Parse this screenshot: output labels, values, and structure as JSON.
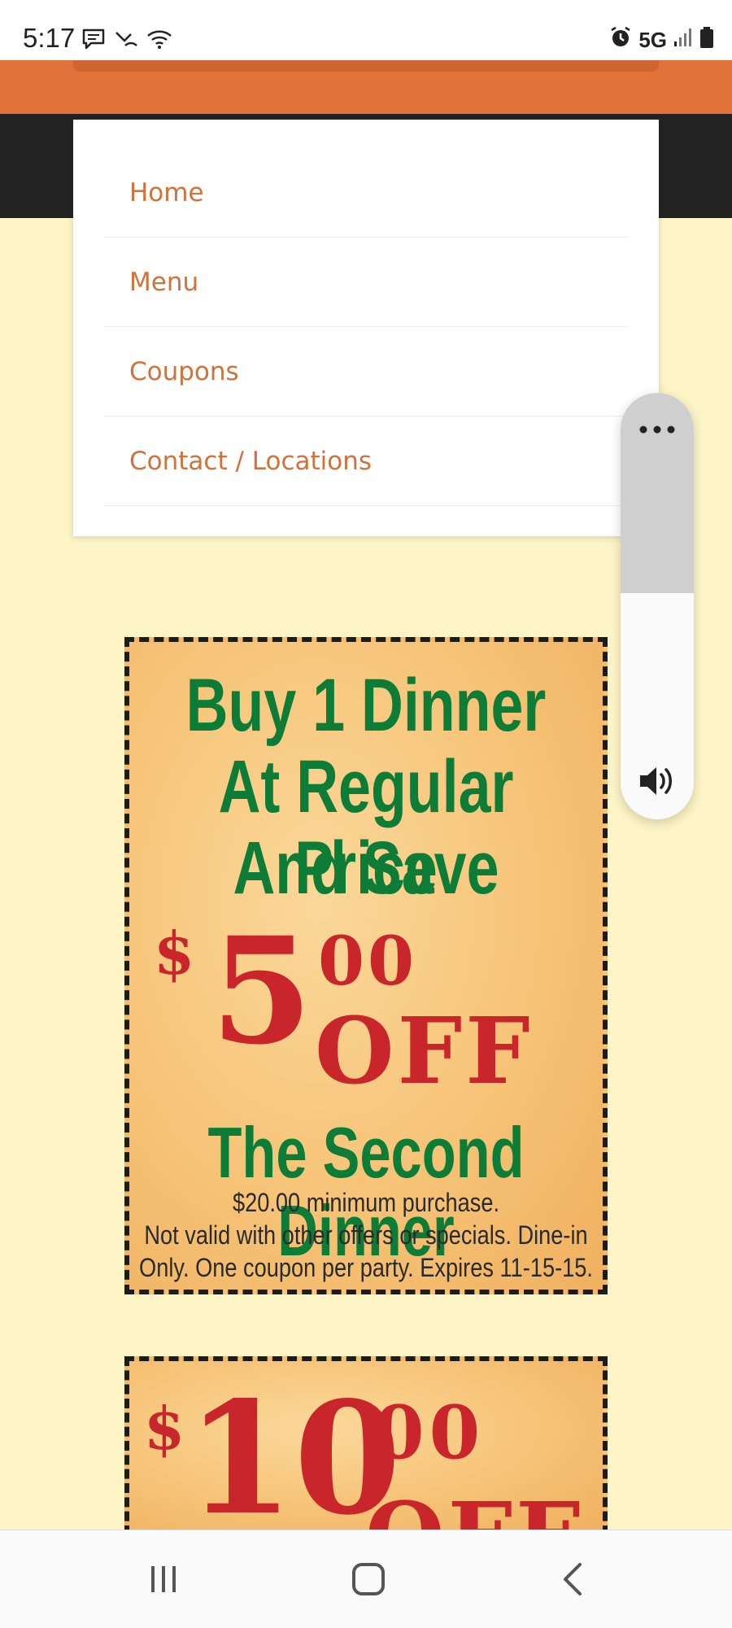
{
  "status_bar": {
    "time": "5:17",
    "network": "5G",
    "icons": [
      "message-icon",
      "missed-call-icon",
      "wifi-icon",
      "alarm-icon",
      "signal-icon",
      "battery-icon"
    ]
  },
  "menu": {
    "items": [
      {
        "label": "Home"
      },
      {
        "label": "Menu"
      },
      {
        "label": "Coupons"
      },
      {
        "label": "Contact / Locations"
      }
    ]
  },
  "coupon1": {
    "line1": "Buy 1 Dinner",
    "line2": "At Regular Price",
    "line3": "And Save",
    "dollar": "$",
    "amount": "5",
    "cents": "00",
    "off": "OFF",
    "line4": "The Second Dinner",
    "fine1": "$20.00 minimum purchase.",
    "fine2": "Not valid with other offers or specials. Dine-in",
    "fine3": "Only. One coupon per party. Expires 11-15-15."
  },
  "coupon2": {
    "dollar": "$",
    "amount": "10",
    "cents": "00",
    "off": "OFF"
  },
  "volume_panel": {
    "more_icon": "more-dots-icon",
    "speaker_icon": "speaker-icon",
    "level": 0.47
  },
  "nav_bar": {
    "buttons": [
      "recent-apps-icon",
      "home-icon",
      "back-icon"
    ]
  },
  "colors": {
    "accent_orange": "#e0723a",
    "menu_text": "#d0723b",
    "page_bg": "#fdf5c6",
    "coupon_green": "#0c7c36",
    "coupon_red": "#c8262b"
  }
}
